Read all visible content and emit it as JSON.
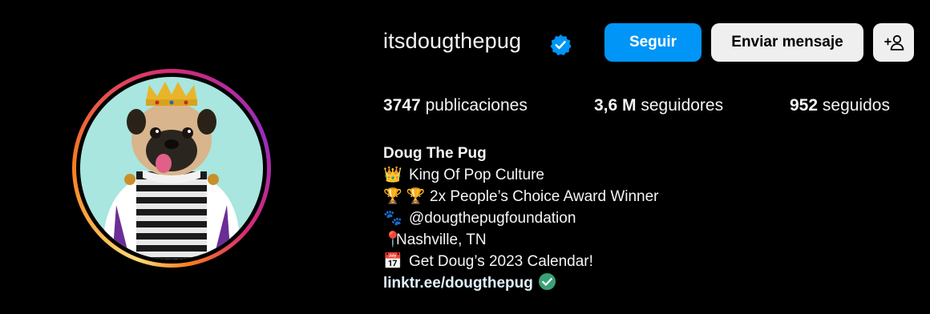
{
  "profile": {
    "username": "itsdougthepug",
    "follow_label": "Seguir",
    "message_label": "Enviar mensaje",
    "suggest_label": "+²",
    "stats": {
      "posts_count": "3747",
      "posts_label": "publicaciones",
      "followers_count": "3,6 M",
      "followers_label": "seguidores",
      "following_count": "952",
      "following_label": "seguidos"
    },
    "bio": {
      "name": "Doug The Pug",
      "line1_emoji": "👑",
      "line1": "King Of Pop Culture",
      "line2_emoji": "🏆 🏆",
      "line2": "2x People’s Choice Award Winner",
      "line3_emoji": "🐾",
      "line3": "@dougthepugfoundation",
      "line4_emoji": "📍",
      "line4": "Nashville, TN",
      "line5_emoji": "📅",
      "line5": "Get Doug’s 2023 Calendar!",
      "link": "linktr.ee/dougthepug"
    }
  },
  "icons": {
    "verified": "verified-badge-icon",
    "add_person": "add-person-icon",
    "link_check": "green-check-icon"
  },
  "colors": {
    "background": "#000000",
    "primary_button": "#0095f6",
    "secondary_button": "#efefef",
    "verified": "#0095f6",
    "link_check": "#3aa176"
  }
}
